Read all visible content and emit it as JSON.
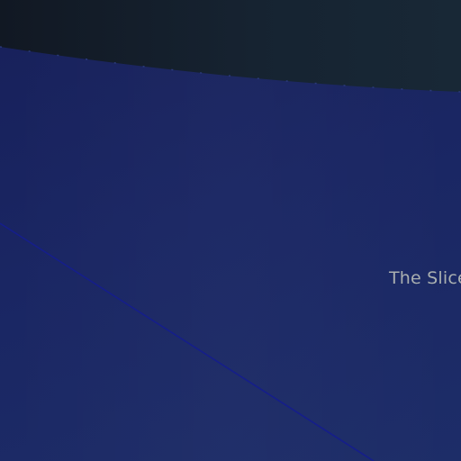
{
  "scene": {
    "label": "The Slice"
  },
  "colors": {
    "background_dark": "#131a24",
    "panel_blue": "#1a2663",
    "divider_line": "#151e8a",
    "label_text": "#a9afb0"
  }
}
